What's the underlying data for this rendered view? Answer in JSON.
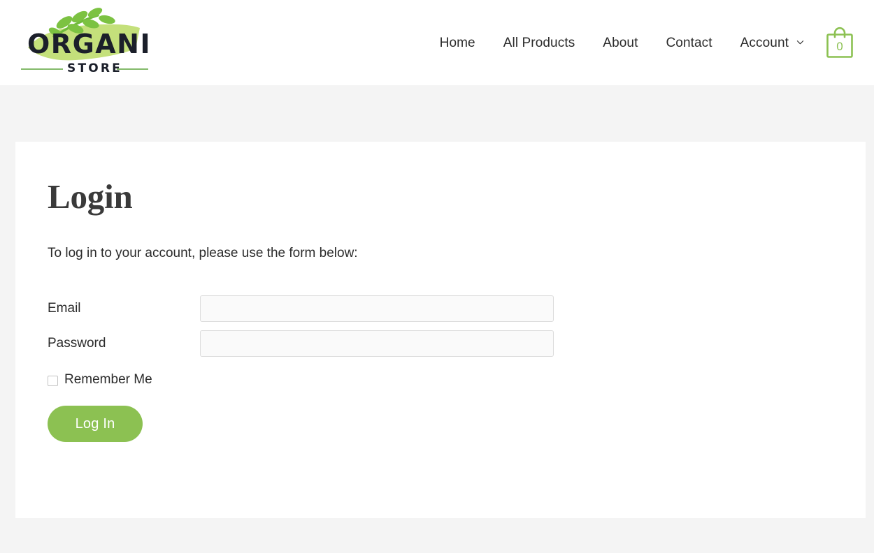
{
  "site": {
    "logo": {
      "word_mark": "ORGANIC",
      "sub_mark": "STORE",
      "brand_green": "#8cc152",
      "leaf_green": "#7cc242",
      "brush_green": "#c4e07b",
      "text_color": "#1b1f2a"
    }
  },
  "header": {
    "nav": [
      {
        "label": "Home",
        "has_submenu": false
      },
      {
        "label": "All Products",
        "has_submenu": false
      },
      {
        "label": "About",
        "has_submenu": false
      },
      {
        "label": "Contact",
        "has_submenu": false
      },
      {
        "label": "Account",
        "has_submenu": true
      }
    ],
    "cart": {
      "icon": "shopping-bag-icon",
      "count": "0",
      "color": "#8cc152"
    }
  },
  "main": {
    "title": "Login",
    "intro": "To log in to your account, please use the form below:",
    "form": {
      "email": {
        "label": "Email",
        "value": "",
        "placeholder": ""
      },
      "password": {
        "label": "Password",
        "value": "",
        "placeholder": ""
      },
      "remember": {
        "label": "Remember Me",
        "checked": false
      },
      "submit_label": "Log In"
    }
  },
  "theme": {
    "page_background": "#f4f4f4",
    "card_background": "#ffffff",
    "accent": "#8cc152",
    "input_background": "#fafafa",
    "input_border": "#dcdcdc"
  }
}
